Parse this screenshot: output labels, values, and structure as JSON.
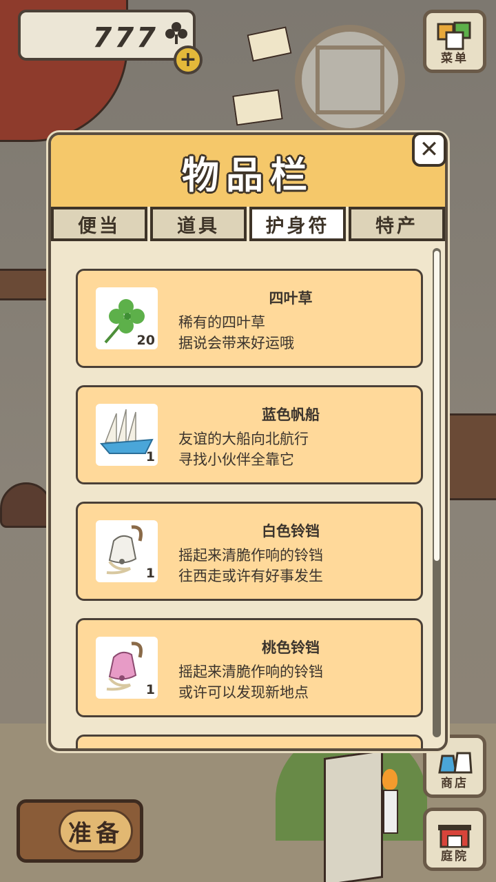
{
  "hud": {
    "clover_count": "777",
    "add_label": "+"
  },
  "side_buttons": {
    "menu": "菜单",
    "shop": "商店",
    "garden": "庭院"
  },
  "prepare_label": "准备",
  "panel": {
    "title": "物品栏",
    "close_label": "✕",
    "tabs": [
      {
        "label": "便当",
        "active": false
      },
      {
        "label": "道具",
        "active": false
      },
      {
        "label": "护身符",
        "active": true
      },
      {
        "label": "特产",
        "active": false
      }
    ],
    "items": [
      {
        "name": "四叶草",
        "line1": "稀有的四叶草",
        "line2": "据说会带来好运哦",
        "qty": "20",
        "icon": "four-leaf-clover-icon"
      },
      {
        "name": "蓝色帆船",
        "line1": "友谊的大船向北航行",
        "line2": "寻找小伙伴全靠它",
        "qty": "1",
        "icon": "blue-sailboat-icon"
      },
      {
        "name": "白色铃铛",
        "line1": "摇起来清脆作响的铃铛",
        "line2": "往西走或许有好事发生",
        "qty": "1",
        "icon": "white-bell-icon"
      },
      {
        "name": "桃色铃铛",
        "line1": "摇起来清脆作响的铃铛",
        "line2": "或许可以发现新地点",
        "qty": "1",
        "icon": "pink-bell-icon"
      }
    ]
  },
  "colors": {
    "header": "#f5c86a",
    "item_card": "#ffd99a",
    "outline": "#3e3428",
    "clover_green": "#5db04a",
    "sail_blue": "#4aa6d9",
    "bell_pink": "#e79bc6"
  }
}
